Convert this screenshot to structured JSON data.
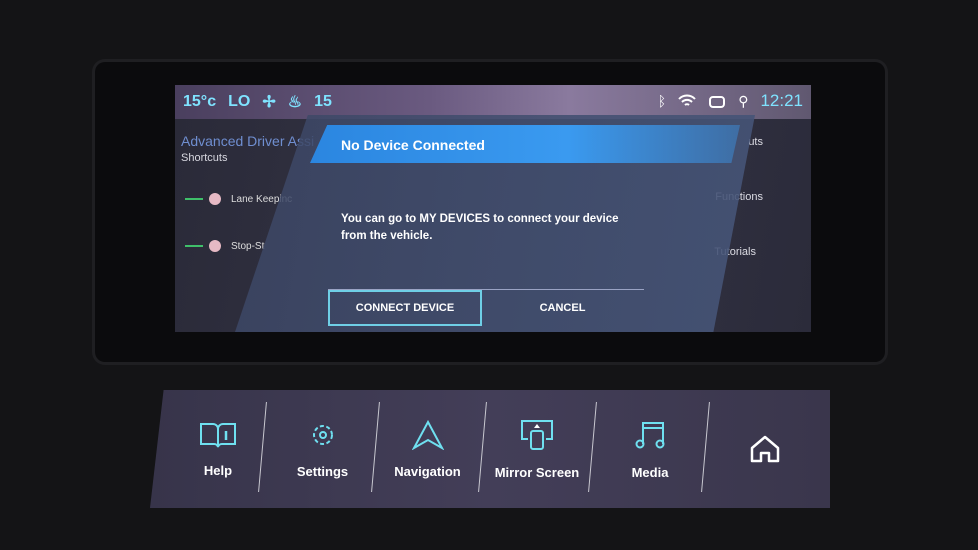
{
  "status_bar": {
    "temperature": "15°c",
    "fan_level": "LO",
    "seat_level": "15",
    "time": "12:21",
    "icons": [
      "fan-icon",
      "seat-heat-icon",
      "bluetooth-icon",
      "wifi-icon",
      "adas-car-icon",
      "location-icon"
    ]
  },
  "background_page": {
    "title": "Advanced Driver Assi",
    "subtitle": "Shortcuts",
    "toggles": [
      {
        "label": "Lane Keepinc",
        "on": true
      },
      {
        "label": "Stop-St",
        "on": true
      }
    ],
    "right_links": [
      "uts",
      "Functions",
      "Tutorials"
    ]
  },
  "dialog": {
    "title": "No Device Connected",
    "message": "You can go to MY DEVICES to connect your device from the vehicle.",
    "primary_button": "CONNECT DEVICE",
    "cancel_button": "CANCEL"
  },
  "dock": {
    "items": [
      {
        "label": "Help",
        "icon": "help-book-icon"
      },
      {
        "label": "Settings",
        "icon": "gear-icon"
      },
      {
        "label": "Navigation",
        "icon": "navigation-arrow-icon"
      },
      {
        "label": "Mirror Screen",
        "icon": "mirror-screen-icon"
      },
      {
        "label": "Media",
        "icon": "music-note-icon"
      }
    ],
    "home_icon": "home-icon"
  },
  "colors": {
    "accent": "#3a9af0",
    "icon": "#7fe3ff",
    "toggle_on": "#3fbf6a"
  }
}
